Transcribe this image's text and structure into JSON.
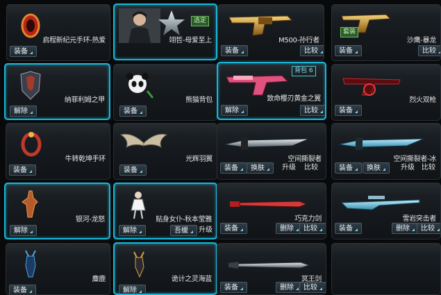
{
  "colors": {
    "selected_border": "#19b8d8",
    "card_bg": "#181c20",
    "tag_green": "#2d5a2a"
  },
  "buttons": {
    "equip": "装备",
    "unequip": "解除",
    "compare": "比较",
    "skin": "换肤",
    "upgrade": "升级",
    "delete": "删除",
    "reset": "吾缓"
  },
  "items": [
    {
      "name": "启程新纪元手环-热爱",
      "icon": "bracelet-icon",
      "selected": false
    },
    {
      "name": "翊哲-母爱至上",
      "icon": "character-icon",
      "selected": true,
      "tag": "选定"
    },
    {
      "name": "M500-孙行者",
      "icon": "revolver-icon",
      "selected": false
    },
    {
      "name": "沙鹰-暴龙",
      "icon": "pistol-icon",
      "selected": false,
      "tag": "套装"
    },
    {
      "name": "纳菲利姆之甲",
      "icon": "armor-icon",
      "selected": true
    },
    {
      "name": "熊猫背包",
      "icon": "panda-icon",
      "selected": false
    },
    {
      "name": "致命樱刃黄金之翼",
      "icon": "pink-gun-icon",
      "selected": true,
      "tag": "背包 6"
    },
    {
      "name": "烈火双枪",
      "icon": "red-gun-icon",
      "selected": false
    },
    {
      "name": "牛转乾坤手环",
      "icon": "bracelet-icon",
      "selected": false
    },
    {
      "name": "光辉羽翼",
      "icon": "wings-icon",
      "selected": false
    },
    {
      "name": "空间撕裂者",
      "icon": "blade-icon",
      "selected": false
    },
    {
      "name": "空间撕裂者-冰",
      "icon": "blade-icon",
      "selected": false
    },
    {
      "name": "银河-龙怒",
      "icon": "figure-icon",
      "selected": true
    },
    {
      "name": "贴身女仆-秋本莹雅",
      "icon": "maid-icon",
      "selected": true
    },
    {
      "name": "巧克力剑",
      "icon": "sword-icon",
      "selected": false
    },
    {
      "name": "雪岩突击者",
      "icon": "sniper-icon",
      "selected": false
    },
    {
      "name": "麋鹿",
      "icon": "deer-icon",
      "selected": false
    },
    {
      "name": "诡计之灵海蓝",
      "icon": "spirit-icon",
      "selected": true
    },
    {
      "name": "冥王剑",
      "icon": "sword-icon",
      "selected": false
    }
  ]
}
